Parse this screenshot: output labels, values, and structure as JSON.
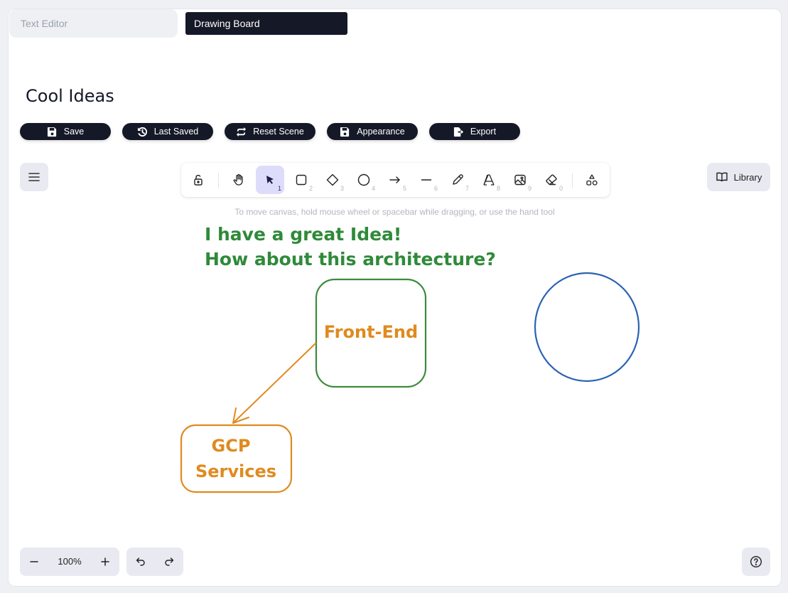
{
  "tabs": [
    {
      "label": "Text Editor",
      "active": false
    },
    {
      "label": "Drawing Board",
      "active": true
    }
  ],
  "page_title": "Cool Ideas",
  "actions": [
    {
      "label": "Save",
      "icon": "save-icon"
    },
    {
      "label": "Last Saved",
      "icon": "history-icon"
    },
    {
      "label": "Reset Scene",
      "icon": "repeat-icon"
    },
    {
      "label": "Appearance",
      "icon": "save-icon"
    },
    {
      "label": "Export",
      "icon": "file-export-icon"
    }
  ],
  "toolbar": {
    "tools": [
      {
        "name": "lock",
        "icon": "lock-open-icon",
        "shortcut": ""
      },
      {
        "name": "hand",
        "icon": "hand-icon",
        "shortcut": ""
      },
      {
        "name": "selection",
        "icon": "pointer-icon",
        "shortcut": "1",
        "active": true
      },
      {
        "name": "rectangle",
        "icon": "square-icon",
        "shortcut": "2"
      },
      {
        "name": "diamond",
        "icon": "diamond-icon",
        "shortcut": "3"
      },
      {
        "name": "ellipse",
        "icon": "circle-icon",
        "shortcut": "4"
      },
      {
        "name": "arrow",
        "icon": "arrow-right-icon",
        "shortcut": "5"
      },
      {
        "name": "line",
        "icon": "line-icon",
        "shortcut": "6"
      },
      {
        "name": "draw",
        "icon": "pencil-icon",
        "shortcut": "7"
      },
      {
        "name": "text",
        "icon": "text-icon",
        "shortcut": "8"
      },
      {
        "name": "image",
        "icon": "image-icon",
        "shortcut": "9"
      },
      {
        "name": "eraser",
        "icon": "eraser-icon",
        "shortcut": "0"
      },
      {
        "name": "more-shapes",
        "icon": "shapes-icon",
        "shortcut": ""
      }
    ],
    "accent_color": "#dedcfb"
  },
  "library_label": "Library",
  "hint": "To move canvas, hold mouse wheel or spacebar while dragging, or use the hand tool",
  "drawing": {
    "note_line1": "I have a great Idea!",
    "note_line2": "How about this architecture?",
    "frontend_label": "Front-End",
    "gcp_line1": "GCP",
    "gcp_line2": "Services",
    "colors": {
      "note": "#2f8a3a",
      "frontend_box": "#3d8b3d",
      "orange": "#e08a1e",
      "circle": "#2a62b3"
    }
  },
  "zoom_level": "100%"
}
